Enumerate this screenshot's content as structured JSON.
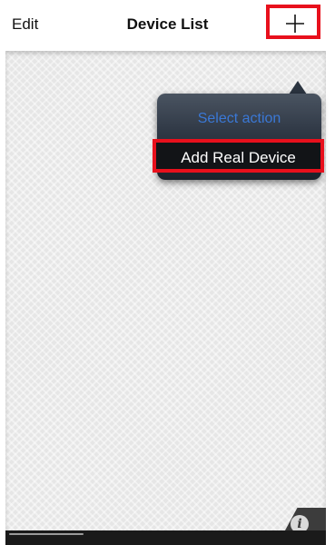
{
  "navbar": {
    "edit_label": "Edit",
    "title": "Device List",
    "add_icon": "plus-icon"
  },
  "popover": {
    "title": "Select action",
    "items": [
      {
        "label": "Add Real Device"
      }
    ]
  },
  "footer": {
    "info_icon": "info-icon",
    "info_glyph": "i"
  },
  "colors": {
    "highlight": "#e8101c",
    "popover_title": "#3a78d6",
    "popover_bg": "#2f3845",
    "content_bg": "#e6e6e6"
  }
}
